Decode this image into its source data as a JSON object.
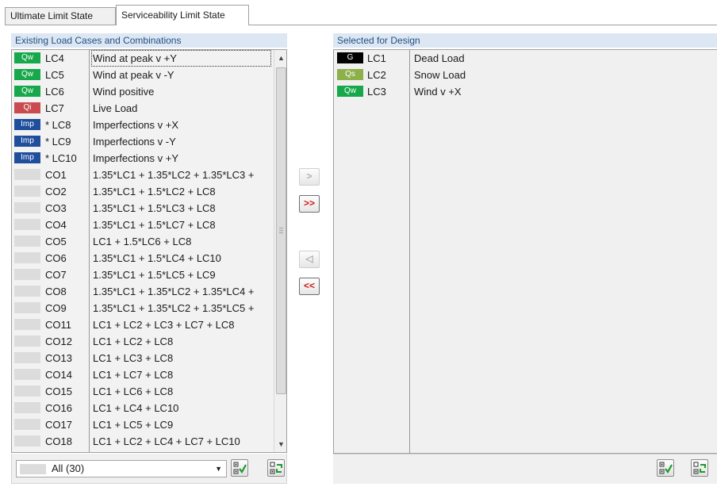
{
  "tabs": [
    {
      "label": "Ultimate Limit State",
      "active": false
    },
    {
      "label": "Serviceability Limit State",
      "active": true
    }
  ],
  "left_panel": {
    "title": "Existing Load Cases and Combinations",
    "rows": [
      {
        "badge": "Qw",
        "badge_color": "#16a84a",
        "id": "LC4",
        "desc": "Wind at peak v +Y",
        "selected": true
      },
      {
        "badge": "Qw",
        "badge_color": "#16a84a",
        "id": "LC5",
        "desc": "Wind at peak v -Y"
      },
      {
        "badge": "Qw",
        "badge_color": "#16a84a",
        "id": "LC6",
        "desc": "Wind positive"
      },
      {
        "badge": "Qi",
        "badge_color": "#c94a4f",
        "id": "LC7",
        "desc": "Live Load"
      },
      {
        "badge": "Imp",
        "badge_color": "#1f4e9c",
        "id": "* LC8",
        "desc": "Imperfections v +X"
      },
      {
        "badge": "Imp",
        "badge_color": "#1f4e9c",
        "id": "* LC9",
        "desc": "Imperfections v -Y"
      },
      {
        "badge": "Imp",
        "badge_color": "#1f4e9c",
        "id": "* LC10",
        "desc": "Imperfections v +Y"
      },
      {
        "badge": "",
        "badge_color": "#dcdcdc",
        "id": "CO1",
        "desc": "1.35*LC1 + 1.35*LC2 + 1.35*LC3 +"
      },
      {
        "badge": "",
        "badge_color": "#dcdcdc",
        "id": "CO2",
        "desc": "1.35*LC1 + 1.5*LC2 + LC8"
      },
      {
        "badge": "",
        "badge_color": "#dcdcdc",
        "id": "CO3",
        "desc": "1.35*LC1 + 1.5*LC3 + LC8"
      },
      {
        "badge": "",
        "badge_color": "#dcdcdc",
        "id": "CO4",
        "desc": "1.35*LC1 + 1.5*LC7 + LC8"
      },
      {
        "badge": "",
        "badge_color": "#dcdcdc",
        "id": "CO5",
        "desc": "LC1 + 1.5*LC6 + LC8"
      },
      {
        "badge": "",
        "badge_color": "#dcdcdc",
        "id": "CO6",
        "desc": "1.35*LC1 + 1.5*LC4 + LC10"
      },
      {
        "badge": "",
        "badge_color": "#dcdcdc",
        "id": "CO7",
        "desc": "1.35*LC1 + 1.5*LC5 + LC9"
      },
      {
        "badge": "",
        "badge_color": "#dcdcdc",
        "id": "CO8",
        "desc": "1.35*LC1 + 1.35*LC2 + 1.35*LC4 +"
      },
      {
        "badge": "",
        "badge_color": "#dcdcdc",
        "id": "CO9",
        "desc": "1.35*LC1 + 1.35*LC2 + 1.35*LC5 +"
      },
      {
        "badge": "",
        "badge_color": "#dcdcdc",
        "id": "CO11",
        "desc": "LC1 + LC2 + LC3 + LC7 + LC8"
      },
      {
        "badge": "",
        "badge_color": "#dcdcdc",
        "id": "CO12",
        "desc": "LC1 + LC2 + LC8"
      },
      {
        "badge": "",
        "badge_color": "#dcdcdc",
        "id": "CO13",
        "desc": "LC1 + LC3 + LC8"
      },
      {
        "badge": "",
        "badge_color": "#dcdcdc",
        "id": "CO14",
        "desc": "LC1 + LC7 + LC8"
      },
      {
        "badge": "",
        "badge_color": "#dcdcdc",
        "id": "CO15",
        "desc": "LC1 + LC6 + LC8"
      },
      {
        "badge": "",
        "badge_color": "#dcdcdc",
        "id": "CO16",
        "desc": "LC1 + LC4 + LC10"
      },
      {
        "badge": "",
        "badge_color": "#dcdcdc",
        "id": "CO17",
        "desc": "LC1 + LC5 + LC9"
      },
      {
        "badge": "",
        "badge_color": "#dcdcdc",
        "id": "CO18",
        "desc": "LC1 + LC2 + LC4 + LC7 + LC10"
      }
    ],
    "filter": {
      "value": "All (30)"
    }
  },
  "transfer": {
    "add_one": ">",
    "add_all": ">>",
    "remove_one": "◁",
    "remove_all": "<<"
  },
  "right_panel": {
    "title": "Selected for Design",
    "rows": [
      {
        "badge": "G",
        "badge_color": "#000000",
        "id": "LC1",
        "desc": "Dead Load"
      },
      {
        "badge": "Qs",
        "badge_color": "#8db04a",
        "id": "LC2",
        "desc": "Snow Load"
      },
      {
        "badge": "Qw",
        "badge_color": "#16a84a",
        "id": "LC3",
        "desc": "Wind v +X"
      }
    ]
  },
  "icons": {
    "select_all": "checklist-check-icon",
    "invert": "checklist-swap-icon"
  }
}
